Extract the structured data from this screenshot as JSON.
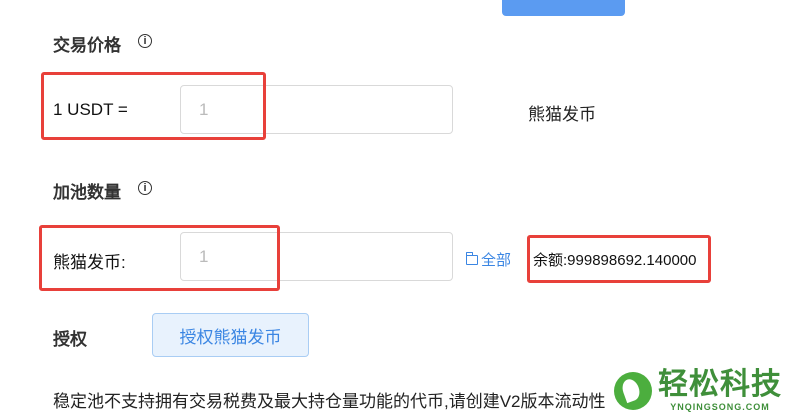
{
  "price_section": {
    "title": "交易价格",
    "pair_label": "1 USDT =",
    "input_placeholder": "1",
    "unit": "熊猫发币"
  },
  "amount_section": {
    "title": "加池数量",
    "token_label": "熊猫发币:",
    "input_placeholder": "1",
    "all_label": "全部",
    "balance_text": "余额:999898692.140000"
  },
  "approve_section": {
    "label": "授权",
    "button_label": "授权熊猫发币"
  },
  "notice": "稳定池不支持拥有交易税费及最大持仓量功能的代币,请创建V2版本流动性",
  "watermark": {
    "cn": "轻松科技",
    "en": "YNQINGSONG.COM"
  },
  "colors": {
    "highlight": "#e8403a",
    "link": "#3b86e3",
    "primary_button": "#5b9bf1",
    "watermark": "#3f8f3a"
  },
  "icons": [
    "info-icon",
    "folder-icon",
    "leaf-logo-icon"
  ]
}
